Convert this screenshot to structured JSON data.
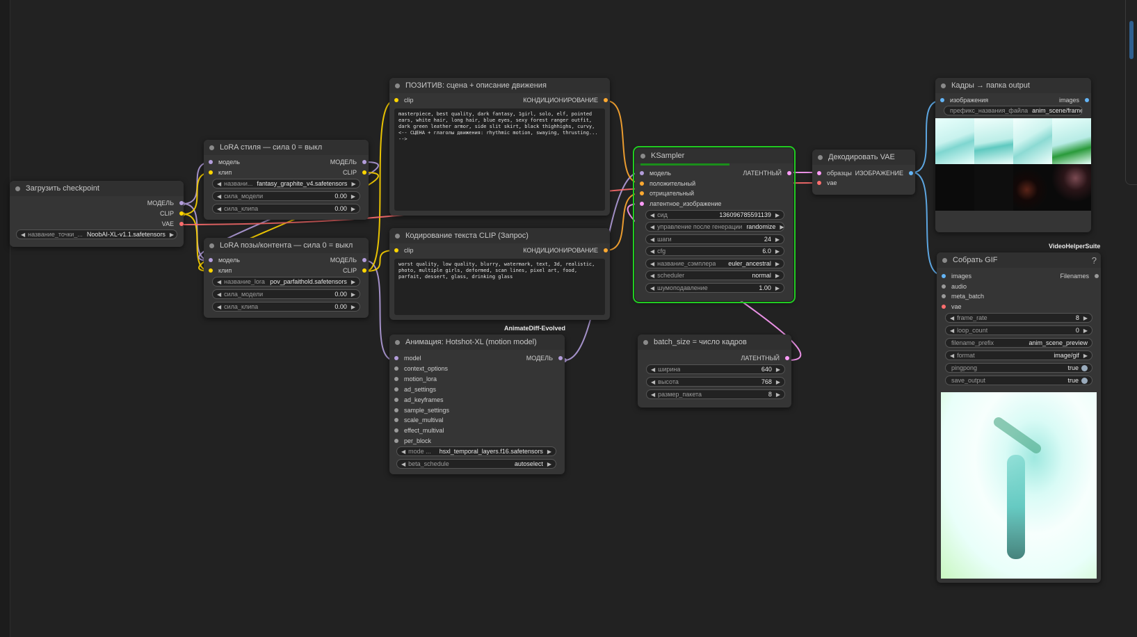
{
  "canvas": {
    "background": "#222222"
  },
  "colors": {
    "model": "#b39ddb",
    "clip": "#ffd500",
    "vae": "#ff6e6e",
    "conditioning": "#ffa931",
    "latent": "#ff9cf9",
    "image": "#64b5f6",
    "neutral": "#9a9a9a",
    "selected": "#22cc22"
  },
  "nodes": {
    "checkpoint": {
      "title": "Загрузить checkpoint",
      "outputs": [
        "МОДЕЛЬ",
        "CLIP",
        "VAE"
      ],
      "widgets": [
        {
          "label": "название_точки_...",
          "value": "NoobAI-XL-v1.1.safetensors"
        }
      ]
    },
    "lora_style": {
      "title": "LoRA стиля — сила 0 = выкл",
      "inputs": [
        "модель",
        "клип"
      ],
      "outputs": [
        "МОДЕЛЬ",
        "CLIP"
      ],
      "widgets": [
        {
          "label": "названи...",
          "value": "fantasy_graphite_v4.safetensors"
        },
        {
          "label": "сила_модели",
          "value": "0.00"
        },
        {
          "label": "сила_клипа",
          "value": "0.00"
        }
      ]
    },
    "lora_pose": {
      "title": "LoRA позы/контента — сила 0 = выкл",
      "inputs": [
        "модель",
        "клип"
      ],
      "outputs": [
        "МОДЕЛЬ",
        "CLIP"
      ],
      "widgets": [
        {
          "label": "название_lora",
          "value": "pov_parfaithold.safetensors"
        },
        {
          "label": "сила_модели",
          "value": "0.00"
        },
        {
          "label": "сила_клипа",
          "value": "0.00"
        }
      ]
    },
    "positive": {
      "title": "ПОЗИТИВ: сцена + описание движения",
      "inputs": [
        "clip"
      ],
      "outputs": [
        "КОНДИЦИОНИРОВАНИЕ"
      ],
      "text": "masterpiece, best quality, dark fantasy, 1girl, solo, elf, pointed ears, white hair, long hair, blue eyes, sexy forest ranger outfit, dark green leather armor, side slit skirt, black thighhighs, curvy, <-- СЦЕНА + глаголы движения: rhythmic motion, swaying, thrusting... -->"
    },
    "negative": {
      "title": "Кодирование текста CLIP (Запрос)",
      "inputs": [
        "clip"
      ],
      "outputs": [
        "КОНДИЦИОНИРОВАНИЕ"
      ],
      "text": "worst quality, low quality, blurry, watermark, text, 3d, realistic, photo, multiple girls, deformed, scan lines, pixel art, food, parfait, dessert, glass, drinking glass"
    },
    "ksampler": {
      "title": "KSampler",
      "progress": 0.56,
      "inputs": [
        "модель",
        "положительный",
        "отрицательный",
        "латентное_изображение"
      ],
      "outputs": [
        "ЛАТЕНТНЫЙ"
      ],
      "widgets": [
        {
          "label": "сид",
          "value": "136096785591139"
        },
        {
          "label": "управление после генерации",
          "value": "randomize"
        },
        {
          "label": "шаги",
          "value": "24"
        },
        {
          "label": "cfg",
          "value": "6.0"
        },
        {
          "label": "название_сэмплера",
          "value": "euler_ancestral"
        },
        {
          "label": "scheduler",
          "value": "normal"
        },
        {
          "label": "шумоподавление",
          "value": "1.00"
        }
      ]
    },
    "vae_decode": {
      "title": "Декодировать VAE",
      "inputs": [
        "образцы",
        "vae"
      ],
      "outputs": [
        "ИЗОБРАЖЕНИЕ"
      ]
    },
    "save_frames": {
      "title": "Кадры → папка output",
      "inputs": [
        "изображения"
      ],
      "outputs": [
        "images"
      ],
      "widgets": [
        {
          "label": "префикс_названия_файла",
          "value": "anim_scene/frame"
        }
      ]
    },
    "animatediff": {
      "group_label": "AnimateDiff-Evolved",
      "title": "Анимация: Hotshot-XL (motion model)",
      "inputs": [
        "model",
        "context_options",
        "motion_lora",
        "ad_settings",
        "ad_keyframes",
        "sample_settings",
        "scale_multival",
        "effect_multival",
        "per_block"
      ],
      "outputs": [
        "МОДЕЛЬ"
      ],
      "widgets": [
        {
          "label": "mode ...",
          "value": "hsxl_temporal_layers.f16.safetensors"
        },
        {
          "label": "beta_schedule",
          "value": "autoselect"
        }
      ]
    },
    "batch": {
      "title": "batch_size = число кадров",
      "outputs": [
        "ЛАТЕНТНЫЙ"
      ],
      "widgets": [
        {
          "label": "ширина",
          "value": "640"
        },
        {
          "label": "высота",
          "value": "768"
        },
        {
          "label": "размер_пакета",
          "value": "8"
        }
      ]
    },
    "gif": {
      "group_label": "VideoHelperSuite",
      "title": "Собрать GIF",
      "help": "?",
      "inputs": [
        "images",
        "audio",
        "meta_batch",
        "vae"
      ],
      "outputs": [
        "Filenames"
      ],
      "widgets": [
        {
          "label": "frame_rate",
          "value": "8"
        },
        {
          "label": "loop_count",
          "value": "0"
        },
        {
          "label": "filename_prefix",
          "value": "anim_scene_preview"
        },
        {
          "label": "format",
          "value": "image/gif"
        },
        {
          "label": "pingpong",
          "value": "true"
        },
        {
          "label": "save_output",
          "value": "true"
        }
      ]
    }
  }
}
